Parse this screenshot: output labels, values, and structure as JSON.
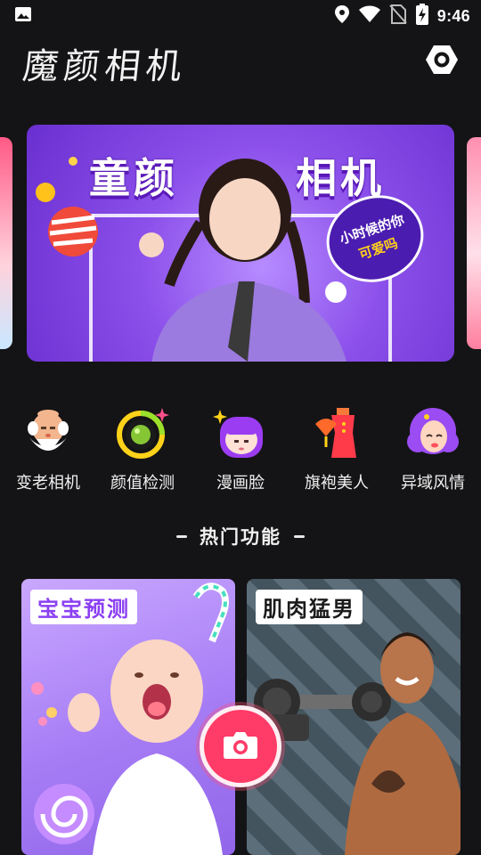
{
  "status_bar": {
    "time": "9:46",
    "icons": [
      "image-icon",
      "location-icon",
      "wifi-icon",
      "no-sim-icon",
      "battery-charging-icon"
    ]
  },
  "header": {
    "title": "魔颜相机",
    "settings_icon": "settings-hexagon-icon"
  },
  "banner": {
    "title_left": "童颜",
    "title_right": "相机",
    "bubble_line1": "小时候的你",
    "bubble_line2": "可爱吗"
  },
  "features": [
    {
      "label": "变老相机",
      "icon": "old-man-icon"
    },
    {
      "label": "颜值检测",
      "icon": "lens-ring-icon"
    },
    {
      "label": "漫画脸",
      "icon": "cartoon-face-icon"
    },
    {
      "label": "旗袍美人",
      "icon": "qipao-icon"
    },
    {
      "label": "异域风情",
      "icon": "exotic-woman-icon"
    }
  ],
  "section": {
    "title": "热门功能"
  },
  "cards": [
    {
      "label": "宝宝预测"
    },
    {
      "label": "肌肉猛男"
    }
  ],
  "fab": {
    "icon": "camera-icon"
  },
  "colors": {
    "background": "#141416",
    "accent": "#ff3b68",
    "banner_purple": "#8b4fea"
  }
}
